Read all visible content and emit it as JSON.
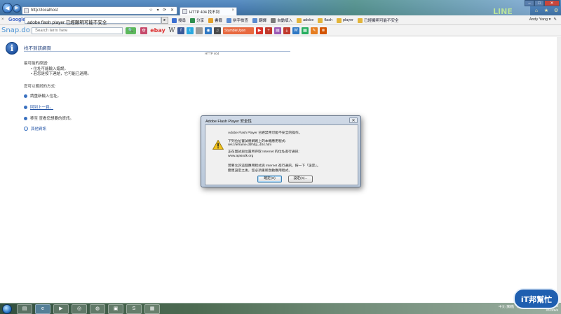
{
  "browser": {
    "address_url": "http://localhost",
    "address_actions": "☆ ▾ ⟳ ✕",
    "tab_title": "HTTP 404 找不到",
    "tab_close": "×",
    "titlebar_logo": "LINE",
    "window_controls": {
      "minimize": "–",
      "maximize": "□",
      "close": "✕"
    }
  },
  "google_toolbar": {
    "brand": "Google",
    "close": "×",
    "search_value": "adobe flash player 已經顯明可能不安全",
    "tools": [
      {
        "label": "搜尋",
        "icon": "search-icon",
        "color": "#3b6fd1"
      },
      {
        "label": "分享",
        "icon": "share-icon",
        "color": "#2f8f4e"
      },
      {
        "label": "書籤",
        "icon": "bookmark-icon",
        "color": "#e2a12b"
      },
      {
        "label": "拼字檢查",
        "icon": "spellcheck-icon",
        "color": "#5a8bd0"
      },
      {
        "label": "翻譯",
        "icon": "translate-icon",
        "color": "#5a8bd0"
      },
      {
        "label": "自動填入",
        "icon": "autofill-icon",
        "color": "#7a7a7a"
      },
      {
        "label": "adobe",
        "icon": "highlight-icon",
        "color": "#e2b43b"
      },
      {
        "label": "flash",
        "icon": "highlight-icon",
        "color": "#e2b43b"
      },
      {
        "label": "player",
        "icon": "highlight-icon",
        "color": "#e2b43b"
      },
      {
        "label": "已經顯明可能不安全",
        "icon": "highlight-icon",
        "color": "#e2b43b"
      }
    ],
    "account": "Andy Yang ▾"
  },
  "snap_toolbar": {
    "logo": "Snap.do",
    "search_placeholder": "Search term here",
    "stumble_label": "StumbleUpon"
  },
  "error_page": {
    "title": "找不到該網頁",
    "code": "HTTP 404",
    "causes_heading": "最可能的原因:",
    "causes": [
      "位址可能輸入錯誤。",
      "若您是按下連結，它可能已過期。"
    ],
    "try_heading": "您可以嘗試的方式:",
    "options": [
      {
        "text": "請重新輸入位址。",
        "link": false
      },
      {
        "text": "回到上一頁。",
        "link": true
      },
      {
        "text": "移至 查看您想要的資訊。",
        "link": false
      }
    ],
    "more_info": "其他資訊"
  },
  "flash_dialog": {
    "title": "Adobe Flash Player 安全性",
    "close": "✕",
    "lines": [
      "Adobe Flash Player 已經禁用可能不安全的操作。",
      "下列位址嘗試將網路上的本機應用程式:",
      "res://ieframe.dll/http_404.htm",
      "正在嘗試與位置所存取 Internet 的位址進行通訊:",
      "www.ajasodk.org",
      "若要允許這個應用程式與 Internet 進行通訊，按一下「設定」。",
      "變更設定之後，您必須重新啟動應用程式。"
    ],
    "button_cancel": "確定(O)",
    "button_settings": "設定(S)..."
  },
  "taskbar": {
    "tray_items": [
      "中文 (繁體)",
      "新注音 2010"
    ],
    "time": "下午 04:10",
    "date": "2013/6/6",
    "watermark": "iT邦幫忙"
  }
}
